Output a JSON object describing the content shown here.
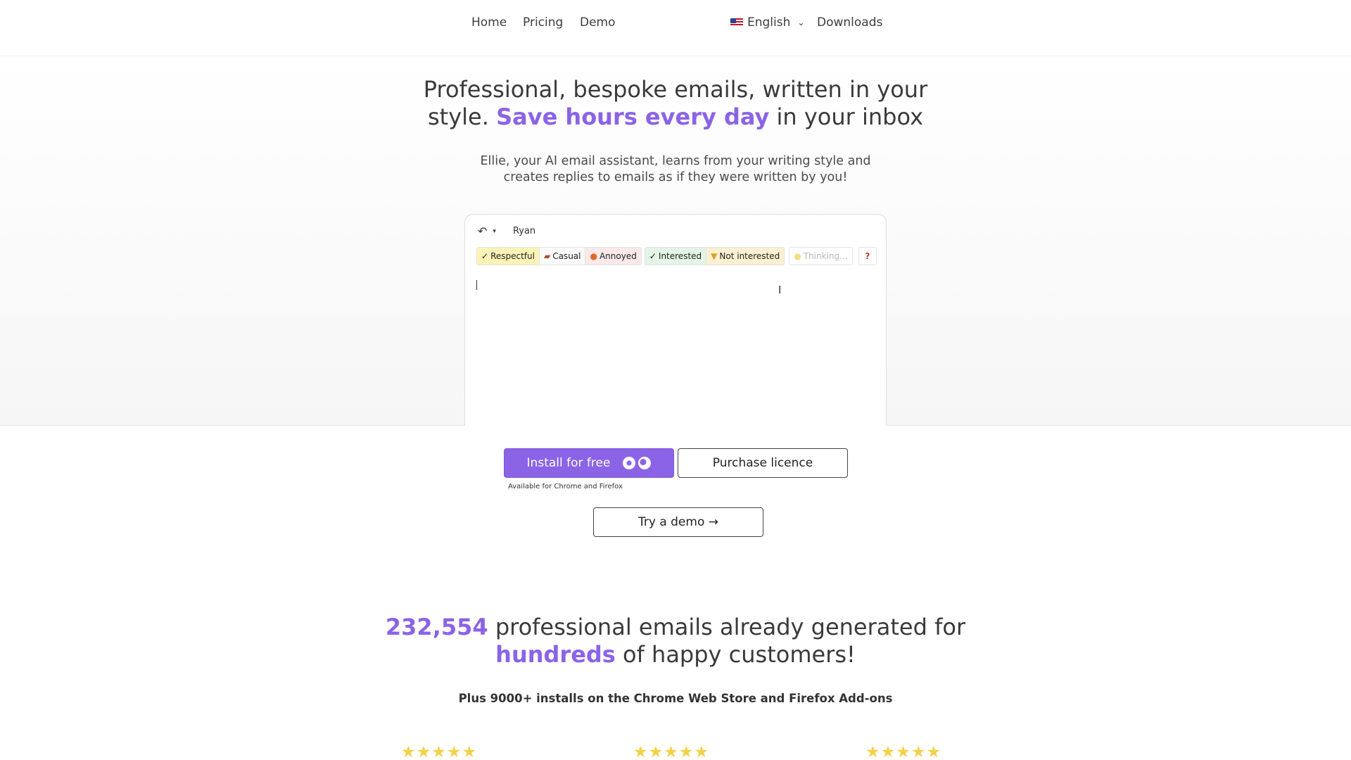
{
  "nav": {
    "links": [
      "Home",
      "Pricing",
      "Demo"
    ],
    "language": "English",
    "downloads": "Downloads"
  },
  "hero": {
    "title_part1": "Professional, bespoke emails, written in your style.",
    "title_accent": "Save hours every day",
    "title_part2": "in your inbox",
    "subtitle": "Ellie, your AI email assistant, learns from your writing style and creates replies to emails as if they were written by you!"
  },
  "editor": {
    "recipient": "Ryan",
    "tones_group1": [
      "Respectful",
      "Casual",
      "Annoyed"
    ],
    "tones_group2": [
      "Interested",
      "Not interested"
    ],
    "thinking_label": "Thinking...",
    "help_label": "?",
    "selected_tone": "Respectful"
  },
  "cta": {
    "install_label": "Install for free",
    "purchase_label": "Purchase licence",
    "availability": "Available for Chrome and Firefox",
    "demo_label": "Try a demo →"
  },
  "stats": {
    "count": "232,554",
    "line1_rest": "professional emails already generated for",
    "accent2": "hundreds",
    "line2_rest": "of happy customers!",
    "subline": "Plus 9000+ installs on the Chrome Web Store and Firefox Add-ons"
  },
  "ratings": {
    "stars_text": "★★★★★",
    "star_color": "#f2d24a"
  },
  "colors": {
    "accent": "#8b63e6"
  }
}
